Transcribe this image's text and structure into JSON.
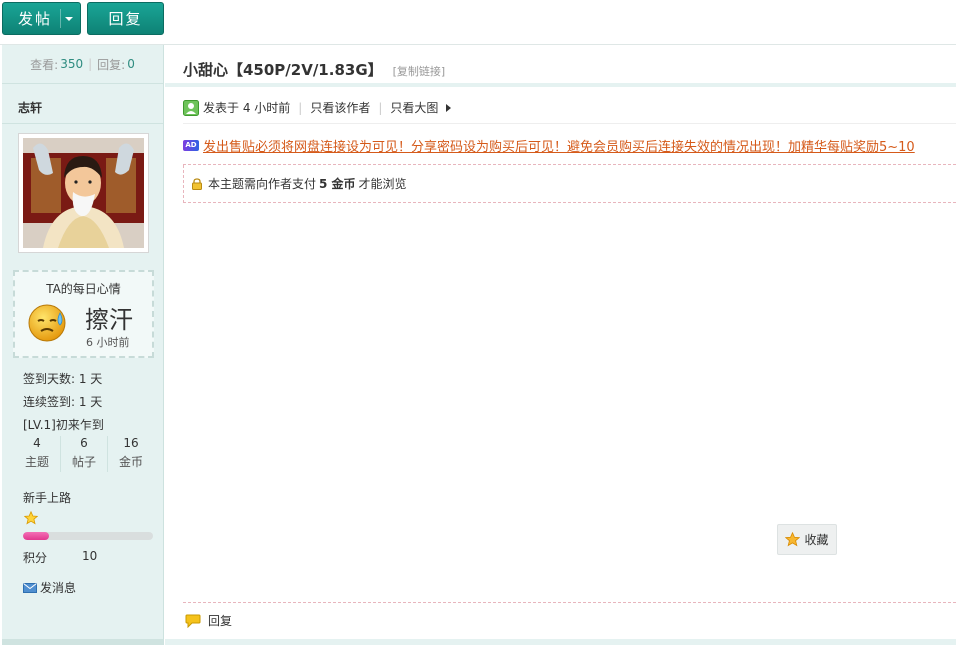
{
  "toolbar": {
    "post_label": "发帖",
    "reply_label": "回复"
  },
  "stats": {
    "views_label": "查看:",
    "views": "350",
    "replies_label": "回复:",
    "replies": "0"
  },
  "author": {
    "name": "志轩"
  },
  "mood": {
    "title": "TA的每日心情",
    "text": "擦汗",
    "time": "6 小时前"
  },
  "signin": {
    "days": "签到天数: 1 天",
    "streak": "连续签到: 1 天",
    "level": "[LV.1]初来乍到"
  },
  "counts": [
    {
      "value": "4",
      "label": "主题"
    },
    {
      "value": "6",
      "label": "帖子"
    },
    {
      "value": "16",
      "label": "金币"
    }
  ],
  "rank": {
    "name": "新手上路",
    "progress_percent": 20,
    "score_label": "积分",
    "score": "10"
  },
  "send_message": "发消息",
  "post": {
    "title": "小甜心【450P/2V/1.83G】",
    "copy_link": "[复制链接]",
    "posted": "发表于 4 小时前",
    "only_author": "只看该作者",
    "only_big_image": "只看大图",
    "ad_badge": "AD",
    "ad_text": "发出售贴必须将网盘连接设为可见！分享密码设为购买后可见！避免会员购买后连接失效的情况出现！加精华每贴奖励5~10",
    "pay_prefix": "本主题需向作者支付",
    "pay_amount": "5 金币",
    "pay_suffix": "才能浏览",
    "favorite": "收藏",
    "reply": "回复"
  },
  "colors": {
    "teal": "#1aa596",
    "sidebar_bg": "#e5f2f1",
    "ad_text": "#d55a1a",
    "progress": "#e2388f"
  }
}
